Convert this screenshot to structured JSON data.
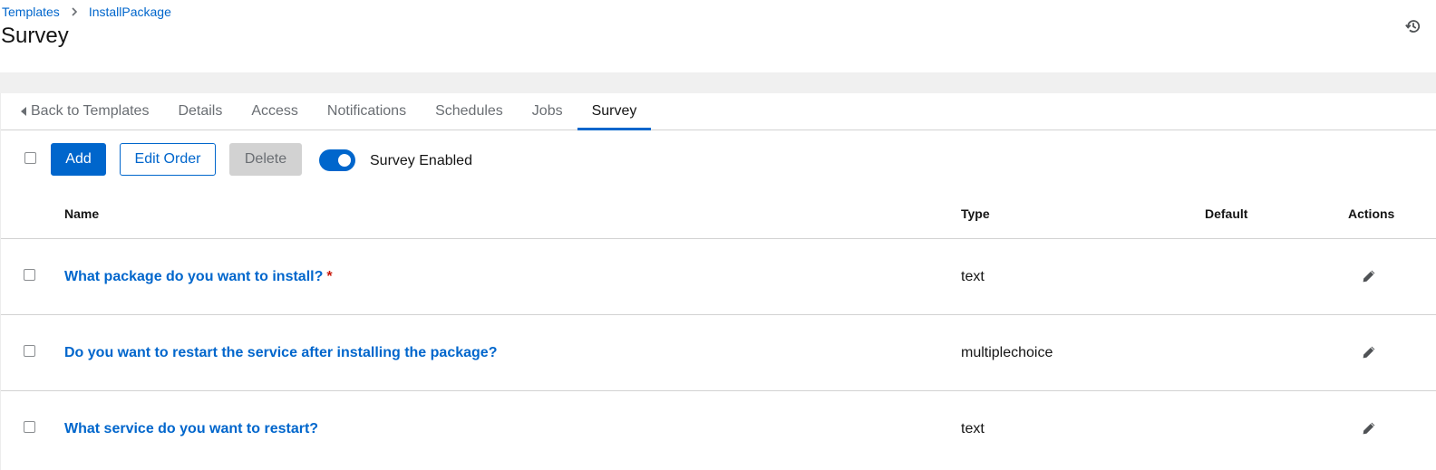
{
  "breadcrumb": {
    "items": [
      "Templates",
      "InstallPackage"
    ]
  },
  "page": {
    "title": "Survey"
  },
  "tabs": [
    {
      "label": "Back to Templates"
    },
    {
      "label": "Details"
    },
    {
      "label": "Access"
    },
    {
      "label": "Notifications"
    },
    {
      "label": "Schedules"
    },
    {
      "label": "Jobs"
    },
    {
      "label": "Survey",
      "active": true
    }
  ],
  "toolbar": {
    "add_label": "Add",
    "edit_order_label": "Edit Order",
    "delete_label": "Delete",
    "survey_enabled_label": "Survey Enabled",
    "survey_enabled": true
  },
  "table": {
    "columns": {
      "name": "Name",
      "type": "Type",
      "default": "Default",
      "actions": "Actions"
    },
    "rows": [
      {
        "name": "What package do you want to install?",
        "required": true,
        "required_mark": "*",
        "type": "text",
        "default": ""
      },
      {
        "name": "Do you want to restart the service after installing the package?",
        "required": false,
        "type": "multiplechoice",
        "default": ""
      },
      {
        "name": "What service do you want to restart?",
        "required": false,
        "type": "text",
        "default": ""
      }
    ]
  },
  "icons": {
    "history": "history-icon",
    "edit": "pencil-icon",
    "breadcrumb_separator": "chevron-right-icon",
    "back": "caret-left-icon"
  },
  "colors": {
    "accent": "#0066cc",
    "required": "#c9190b",
    "band": "#f0f0f0",
    "border": "#d2d2d2"
  }
}
